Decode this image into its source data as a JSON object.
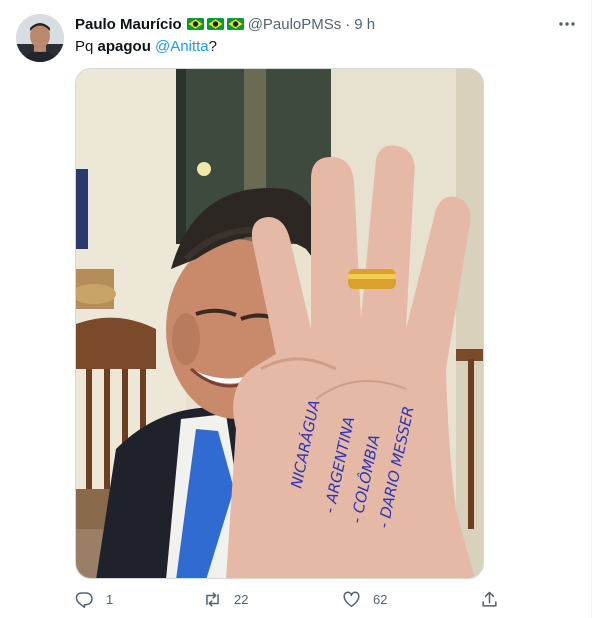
{
  "tweet": {
    "author_name": "Paulo Maurício",
    "author_flags": [
      "brazil-flag",
      "brazil-flag",
      "brazil-flag"
    ],
    "handle": "@PauloPMSs",
    "separator": "·",
    "time": "9 h",
    "text_prefix": "Pq ",
    "text_bold": "apagou",
    "text_space": " ",
    "mention": "@Anitta",
    "text_suffix": "?"
  },
  "media": {
    "handwriting": [
      "NICARÁGUA",
      "- ARGENTINA",
      "- COLÔMBIA",
      "- DARIO MESSER"
    ]
  },
  "actions": {
    "reply_count": "1",
    "retweet_count": "22",
    "like_count": "62"
  },
  "colors": {
    "accent": "#1d9bf0",
    "secondary_text": "#536471",
    "ink": "#2a36b8"
  }
}
